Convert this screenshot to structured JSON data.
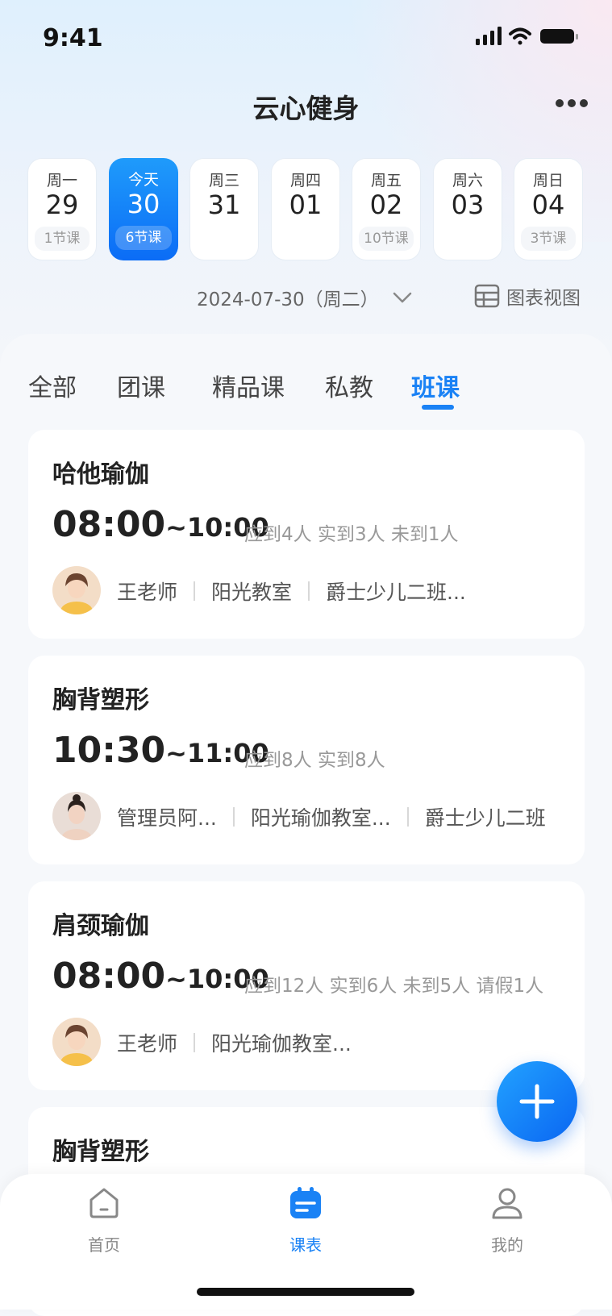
{
  "status_bar": {
    "time": "9:41"
  },
  "header": {
    "title": "云心健身"
  },
  "week": [
    {
      "weekday": "周一",
      "date": "29",
      "count": "1节课",
      "active": false
    },
    {
      "weekday": "今天",
      "date": "30",
      "count": "6节课",
      "active": true
    },
    {
      "weekday": "周三",
      "date": "31",
      "count": "",
      "active": false
    },
    {
      "weekday": "周四",
      "date": "01",
      "count": "",
      "active": false
    },
    {
      "weekday": "周五",
      "date": "02",
      "count": "10节课",
      "active": false
    },
    {
      "weekday": "周六",
      "date": "03",
      "count": "",
      "active": false
    },
    {
      "weekday": "周日",
      "date": "04",
      "count": "3节课",
      "active": false
    }
  ],
  "date_selector": {
    "text": "2024-07-30（周二）",
    "chart_view_label": "图表视图"
  },
  "tabs": [
    {
      "label": "全部",
      "active": false
    },
    {
      "label": "团课",
      "active": false
    },
    {
      "label": "精品课",
      "active": false
    },
    {
      "label": "私教",
      "active": false
    },
    {
      "label": "班课",
      "active": true
    }
  ],
  "courses": [
    {
      "name": "哈他瑜伽",
      "start": "08:00",
      "end": "~10:00",
      "stats": "应到4人  实到3人  未到1人",
      "teacher": "王老师",
      "room": "阳光教室",
      "klass": "爵士少儿二班..."
    },
    {
      "name": "胸背塑形",
      "start": "10:30",
      "end": "~11:00",
      "stats": "应到8人  实到8人",
      "teacher": "管理员阿...",
      "room": "阳光瑜伽教室...",
      "klass": "爵士少儿二班"
    },
    {
      "name": "肩颈瑜伽",
      "start": "08:00",
      "end": "~10:00",
      "stats": "应到12人  实到6人  未到5人  请假1人",
      "teacher": "王老师",
      "room": "阳光瑜伽教室...",
      "klass": ""
    },
    {
      "name": "胸背塑形"
    }
  ],
  "tabbar": [
    {
      "label": "首页",
      "icon": "home-icon",
      "active": false
    },
    {
      "label": "课表",
      "icon": "calendar-icon",
      "active": true
    },
    {
      "label": "我的",
      "icon": "user-icon",
      "active": false
    }
  ],
  "colors": {
    "accent": "#1a82f5",
    "active_day_top": "#1f9bfb",
    "active_day_bottom": "#0b6cf6"
  }
}
